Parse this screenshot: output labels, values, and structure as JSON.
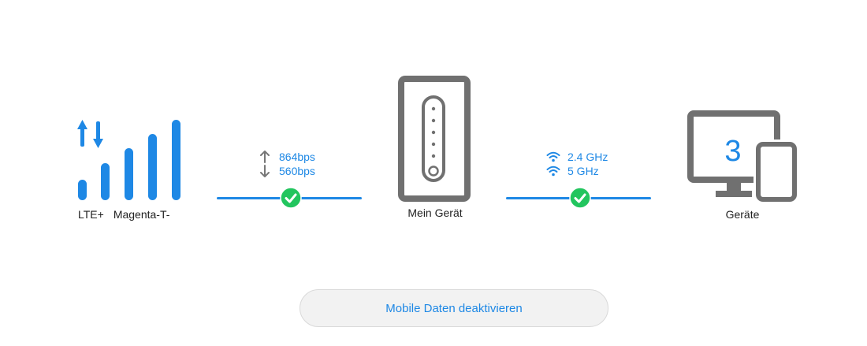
{
  "network": {
    "type_label": "LTE+",
    "operator_label": "Magenta-T-",
    "signal_icon": "signal-bars-icon"
  },
  "mobile_link": {
    "upload_rate": "864bps",
    "download_rate": "560bps",
    "status_icon": "check-circle-icon"
  },
  "router": {
    "label": "Mein Gerät",
    "icon": "router-icon"
  },
  "wifi_link": {
    "band_1": "2.4 GHz",
    "band_2": "5 GHz",
    "status_icon": "check-circle-icon"
  },
  "devices": {
    "count": "3",
    "label": "Geräte",
    "icon": "devices-icon"
  },
  "actions": {
    "deactivate_label": "Mobile Daten deaktivieren"
  },
  "colors": {
    "accent": "#1e88e5",
    "success": "#22c55e",
    "device_gray": "#707070"
  }
}
